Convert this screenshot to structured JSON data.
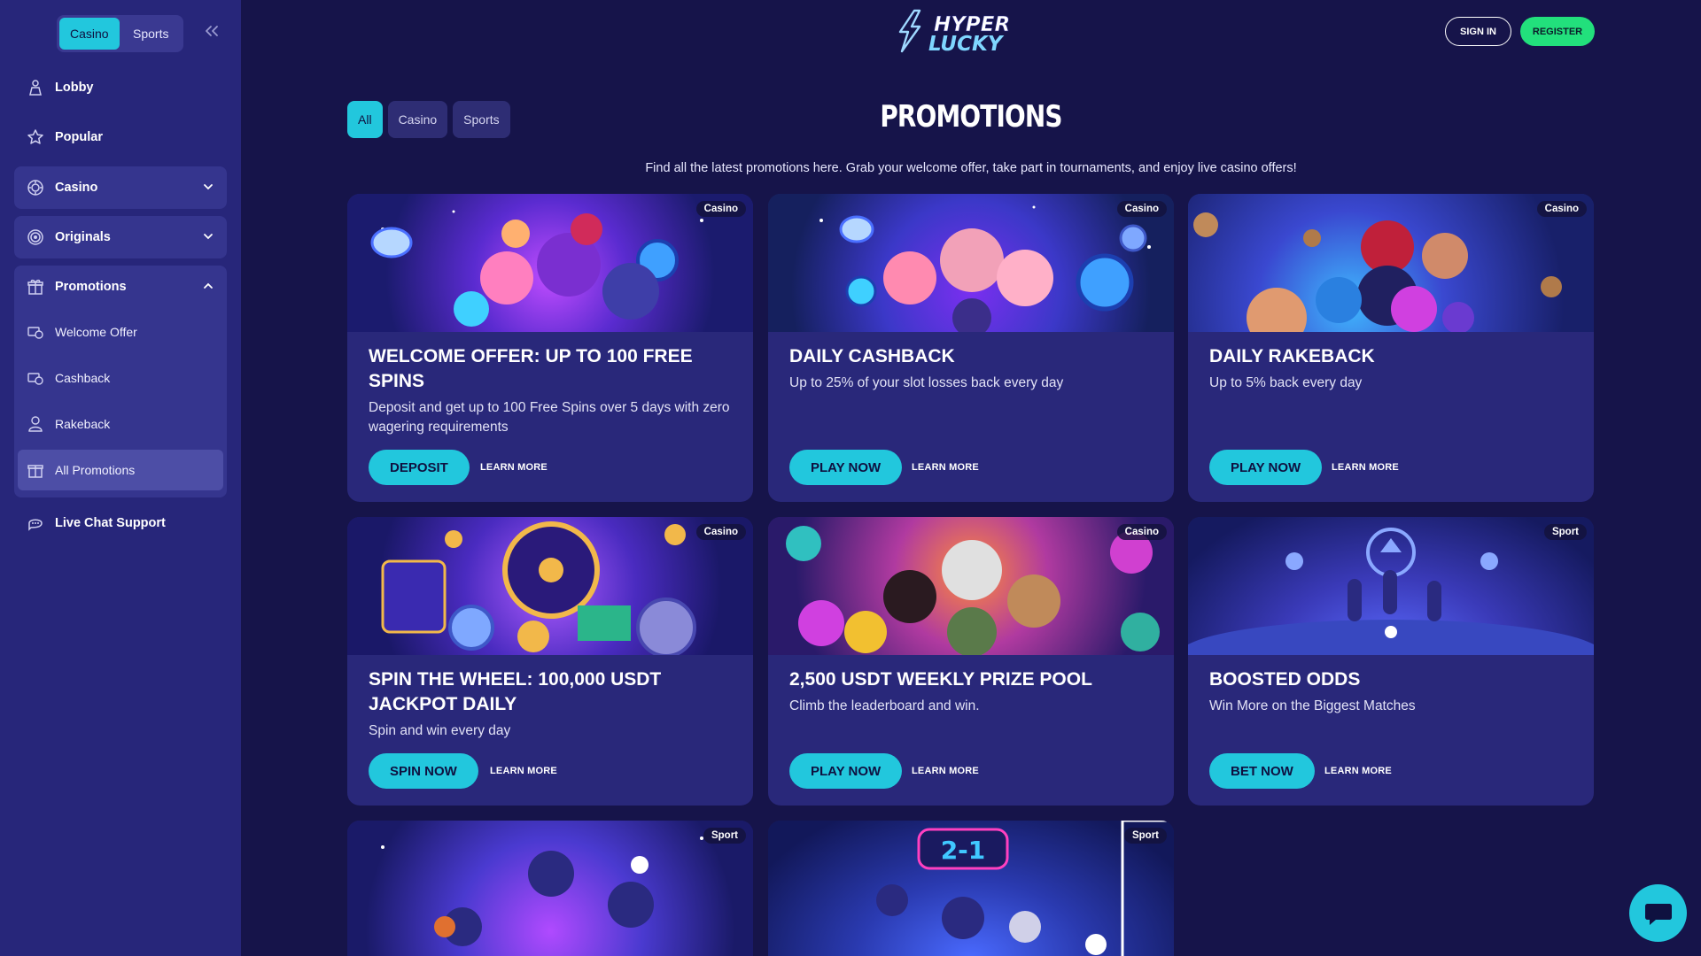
{
  "sidebar": {
    "vertical_toggle": {
      "casino": "Casino",
      "sports": "Sports"
    },
    "nav": {
      "lobby": "Lobby",
      "popular": "Popular",
      "casino": "Casino",
      "originals": "Originals",
      "promotions": "Promotions",
      "live_chat": "Live Chat Support"
    },
    "promotions_sub": [
      {
        "label": "Welcome Offer"
      },
      {
        "label": "Cashback"
      },
      {
        "label": "Rakeback"
      },
      {
        "label": "All Promotions"
      }
    ]
  },
  "header": {
    "logo_line1": "HYPER",
    "logo_line2": "LUCKY",
    "sign_in": "SIGN IN",
    "register": "REGISTER"
  },
  "main": {
    "filters": [
      "All",
      "Casino",
      "Sports"
    ],
    "title": "PROMOTIONS",
    "description": "Find all the latest promotions here. Grab your welcome offer, take part in tournaments, and enjoy live casino offers!"
  },
  "cards": [
    {
      "tag": "Casino",
      "title": "WELCOME OFFER: UP TO 100 FREE SPINS",
      "desc": "Deposit and get up to 100 Free Spins over 5 days with zero wagering requirements",
      "cta": "DEPOSIT",
      "learn": "LEARN MORE"
    },
    {
      "tag": "Casino",
      "title": "DAILY CASHBACK",
      "desc": "Up to 25% of your slot losses back every day",
      "cta": "PLAY NOW",
      "learn": "LEARN MORE"
    },
    {
      "tag": "Casino",
      "title": "DAILY RAKEBACK",
      "desc": "Up to 5% back every day",
      "cta": "PLAY NOW",
      "learn": "LEARN MORE"
    },
    {
      "tag": "Casino",
      "title": "SPIN THE WHEEL: 100,000 USDT JACKPOT DAILY",
      "desc": "Spin and win every day",
      "cta": "SPIN NOW",
      "learn": "LEARN MORE"
    },
    {
      "tag": "Casino",
      "title": "2,500 USDT WEEKLY PRIZE POOL",
      "desc": "Climb the leaderboard and win.",
      "cta": "PLAY NOW",
      "learn": "LEARN MORE"
    },
    {
      "tag": "Sport",
      "title": "BOOSTED ODDS",
      "desc": "Win More on the Biggest Matches",
      "cta": "BET NOW",
      "learn": "LEARN MORE"
    },
    {
      "tag": "Sport"
    },
    {
      "tag": "Sport",
      "score": "2-1"
    }
  ],
  "colors": {
    "background": "#16144a",
    "sidebar": "#27267a",
    "card": "#29287a",
    "accent_cyan": "#22c7dd",
    "accent_green": "#22e07c"
  },
  "icons": [
    "lobby-icon",
    "star-icon",
    "casino-chip-icon",
    "originals-icon",
    "gift-icon",
    "money-icon",
    "rakeback-icon",
    "chat-icon",
    "chevron-down-icon",
    "chevron-up-icon",
    "double-chevron-left-icon"
  ]
}
